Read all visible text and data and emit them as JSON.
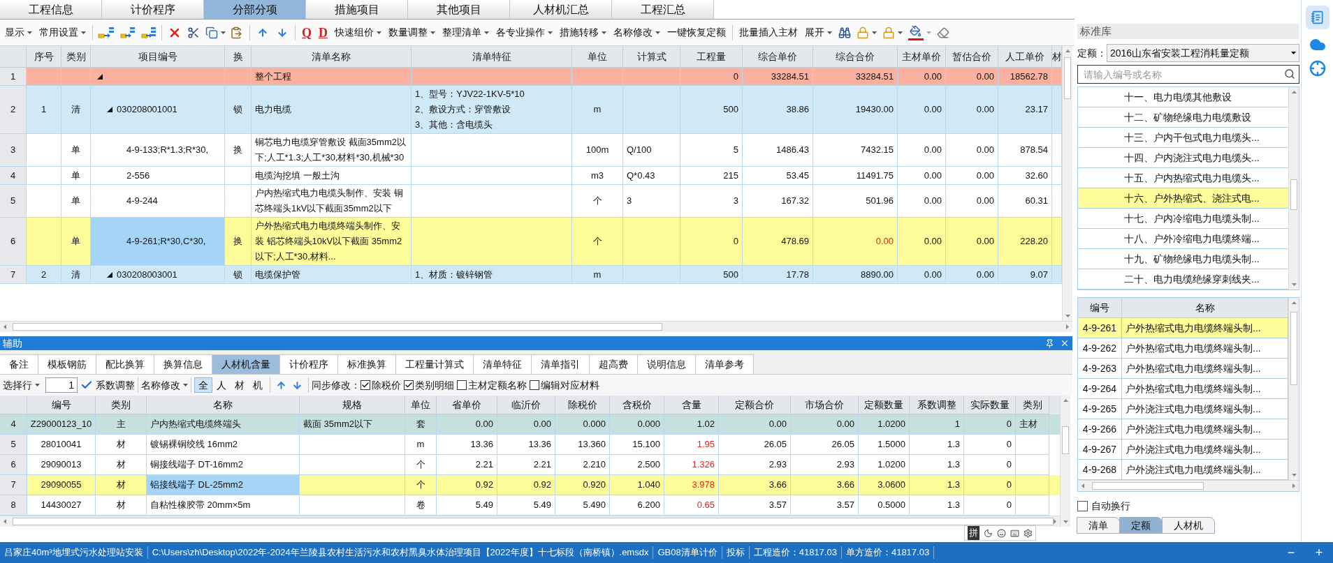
{
  "top_tabs": [
    {
      "label": "工程信息",
      "selected": false
    },
    {
      "label": "计价程序",
      "selected": false
    },
    {
      "label": "分部分项",
      "selected": true
    },
    {
      "label": "措施项目",
      "selected": false
    },
    {
      "label": "其他项目",
      "selected": false
    },
    {
      "label": "人材机汇总",
      "selected": false
    },
    {
      "label": "工程汇总",
      "selected": false
    }
  ],
  "toolbar": {
    "menus_a": [
      {
        "label": "显示",
        "dropdown": true
      },
      {
        "label": "常用设置",
        "dropdown": true
      }
    ],
    "marks": [
      "Q",
      "D"
    ],
    "menus_b": [
      {
        "label": "快速组价",
        "dropdown": true
      },
      {
        "label": "数量调整",
        "dropdown": true
      },
      {
        "label": "整理清单",
        "dropdown": true
      },
      {
        "label": "各专业操作",
        "dropdown": true
      },
      {
        "label": "措施转移",
        "dropdown": true
      },
      {
        "label": "名称修改",
        "dropdown": true
      },
      {
        "label": "一键恢复定额",
        "dropdown": false
      }
    ],
    "menus_c": [
      {
        "label": "批量插入主材",
        "dropdown": false
      },
      {
        "label": "展开",
        "dropdown": true
      }
    ]
  },
  "main_table": {
    "columns": [
      "序号",
      "类别",
      "项目编号",
      "换",
      "清单名称",
      "清单特征",
      "单位",
      "计算式",
      "工程量",
      "综合单价",
      "综合合价",
      "主材单价",
      "暂估合价",
      "人工单价",
      "材"
    ],
    "rows": [
      {
        "row_no": "1",
        "expanded": true,
        "selected": false,
        "flagged": false,
        "cells": {
          "name": "整个工程",
          "qty": "0",
          "unit_price": "33284.51",
          "total": "33284.51",
          "main_mat": "0.00",
          "est": "0.00",
          "labor": "18562.78"
        },
        "children": [
          {
            "row_no": "2",
            "expanded": true,
            "selected": false,
            "flagged": false,
            "cells": {
              "seq": "1",
              "type": "清",
              "code": "030208001001",
              "swap": "锁",
              "name": "电力电缆",
              "feature": "1、型号：YJV22-1KV-5*10\n2、敷设方式：穿管敷设\n3、其他：含电缆头",
              "unit": "m",
              "qty": "500",
              "unit_price": "38.86",
              "total": "19430.00",
              "main_mat": "0.00",
              "est": "0.00",
              "labor": "23.17"
            },
            "children": [
              {
                "row_no": "3",
                "selected": false,
                "flagged": false,
                "cells": {
                  "type": "单",
                  "code": "4-9-133;R*1.3;R*30,",
                  "swap": "换",
                  "name": "铜芯电力电缆穿管敷设 截面35mm2以下;人工*1.3;人工*30,材料*30,机械*30",
                  "unit": "100m",
                  "formula": "Q/100",
                  "qty": "5",
                  "unit_price": "1486.43",
                  "total": "7432.15",
                  "main_mat": "0.00",
                  "est": "0.00",
                  "labor": "878.54"
                }
              },
              {
                "row_no": "4",
                "selected": false,
                "flagged": false,
                "cells": {
                  "type": "单",
                  "code": "2-556",
                  "name": "电缆沟挖填 一般土沟",
                  "unit": "m3",
                  "formula": "Q*0.43",
                  "qty": "215",
                  "unit_price": "53.45",
                  "total": "11491.75",
                  "main_mat": "0.00",
                  "est": "0.00",
                  "labor": "32.60"
                }
              },
              {
                "row_no": "5",
                "selected": false,
                "flagged": false,
                "cells": {
                  "type": "单",
                  "code": "4-9-244",
                  "name": "户内热缩式电力电缆头制作、安装 铜芯终端头1kV以下截面35mm2以下",
                  "unit": "个",
                  "formula": "3",
                  "qty": "3",
                  "unit_price": "167.32",
                  "total": "501.96",
                  "main_mat": "0.00",
                  "est": "0.00",
                  "labor": "60.31"
                }
              },
              {
                "row_no": "6",
                "selected": true,
                "flagged": true,
                "cells": {
                  "type": "单",
                  "code": "4-9-261;R*30,C*30,",
                  "swap": "换",
                  "name": "户外热缩式电力电缆终端头制作、安装 铝芯终端头10kV以下截面 35mm2以下;人工*30,材料...",
                  "unit": "个",
                  "qty": "0",
                  "unit_price": "478.69",
                  "total": "0.00",
                  "main_mat": "0.00",
                  "est": "0.00",
                  "labor": "228.20"
                }
              }
            ]
          },
          {
            "row_no": "7",
            "expanded": true,
            "selected": false,
            "flagged": false,
            "cells": {
              "seq": "2",
              "type": "清",
              "code": "030208003001",
              "swap": "锁",
              "name": "电缆保护管",
              "feature": "1、材质：镀锌钢管",
              "unit": "m",
              "qty": "500",
              "unit_price": "17.78",
              "total": "8890.00",
              "main_mat": "0.00",
              "est": "0.00",
              "labor": "9.07"
            }
          }
        ]
      }
    ]
  },
  "assist": {
    "title": "辅助",
    "tabs": [
      {
        "label": "备注",
        "selected": false
      },
      {
        "label": "模板钢筋",
        "selected": false
      },
      {
        "label": "配比换算",
        "selected": false
      },
      {
        "label": "换算信息",
        "selected": false
      },
      {
        "label": "人材机含量",
        "selected": true
      },
      {
        "label": "计价程序",
        "selected": false
      },
      {
        "label": "标准换算",
        "selected": false
      },
      {
        "label": "工程量计算式",
        "selected": false
      },
      {
        "label": "清单特征",
        "selected": false
      },
      {
        "label": "清单指引",
        "selected": false
      },
      {
        "label": "超高费",
        "selected": false
      },
      {
        "label": "说明信息",
        "selected": false
      },
      {
        "label": "清单参考",
        "selected": false
      }
    ],
    "toolbar": {
      "select_row": "选择行",
      "row_value": "1",
      "coef": "系数调整",
      "rename": "名称修改",
      "filters": [
        {
          "label": "全",
          "selected": true
        },
        {
          "label": "人",
          "selected": false
        },
        {
          "label": "材",
          "selected": false
        },
        {
          "label": "机",
          "selected": false
        }
      ],
      "sync_label": "同步修改：",
      "options": [
        {
          "label": "除税价",
          "checked": true
        },
        {
          "label": "类别明细",
          "checked": true
        },
        {
          "label": "主材定额名称",
          "checked": false
        },
        {
          "label": "编辑对应材料",
          "checked": false
        }
      ]
    },
    "table": {
      "columns": [
        "编号",
        "类别",
        "名称",
        "规格",
        "单位",
        "省单价",
        "临沂价",
        "除税价",
        "含税价",
        "含量",
        "定额合价",
        "市场合价",
        "定额数量",
        "系数调整",
        "实际数量",
        "类别"
      ],
      "rows": [
        {
          "row_no": "4",
          "kind": "main",
          "selected": false,
          "changed": false,
          "cells": {
            "code": "Z29000123_10",
            "cat": "主",
            "name": "户内热缩式电缆终端头",
            "spec": "截面 35mm2以下",
            "unit": "套",
            "prov": "0.00",
            "linyi": "0.00",
            "notax": "0.000",
            "tax": "0.000",
            "content": "1.02",
            "quota_total": "0.00",
            "market_total": "0.00",
            "quota_qty": "1.0200",
            "coef": "1",
            "actual": "0",
            "category": "主材"
          }
        },
        {
          "row_no": "5",
          "kind": "material",
          "selected": false,
          "changed": true,
          "cells": {
            "code": "28010041",
            "cat": "材",
            "name": "镀锡裸铜绞线 16mm2",
            "unit": "m",
            "prov": "13.36",
            "linyi": "13.36",
            "notax": "13.360",
            "tax": "15.100",
            "content": "1.95",
            "quota_total": "26.05",
            "market_total": "26.05",
            "quota_qty": "1.5000",
            "coef": "1.3",
            "actual": "0"
          }
        },
        {
          "row_no": "6",
          "kind": "material",
          "selected": false,
          "changed": true,
          "cells": {
            "code": "29090013",
            "cat": "材",
            "name": "铜接线端子 DT-16mm2",
            "unit": "个",
            "prov": "2.21",
            "linyi": "2.21",
            "notax": "2.210",
            "tax": "2.500",
            "content": "1.326",
            "quota_total": "2.93",
            "market_total": "2.93",
            "quota_qty": "1.0200",
            "coef": "1.3",
            "actual": "0"
          }
        },
        {
          "row_no": "7",
          "kind": "material",
          "selected": true,
          "changed": true,
          "cells": {
            "code": "29090055",
            "cat": "材",
            "name": "铝接线端子 DL-25mm2",
            "unit": "个",
            "prov": "0.92",
            "linyi": "0.92",
            "notax": "0.920",
            "tax": "1.040",
            "content": "3.978",
            "quota_total": "3.66",
            "market_total": "3.66",
            "quota_qty": "3.0600",
            "coef": "1.3",
            "actual": "0"
          }
        },
        {
          "row_no": "8",
          "kind": "material",
          "selected": false,
          "changed": true,
          "cells": {
            "code": "14430027",
            "cat": "材",
            "name": "自粘性橡胶带 20mm×5m",
            "unit": "卷",
            "prov": "5.49",
            "linyi": "5.49",
            "notax": "5.490",
            "tax": "6.200",
            "content": "0.65",
            "quota_total": "3.57",
            "market_total": "3.57",
            "quota_qty": "0.5000",
            "coef": "1.3",
            "actual": "0"
          }
        }
      ]
    }
  },
  "library": {
    "title": "标准库",
    "quota_label": "定额：",
    "quota_value": "2016山东省安装工程消耗量定额",
    "search_placeholder": "请输入编号或名称",
    "chapters": [
      {
        "label": "十一、电力电缆其他敷设",
        "selected": false
      },
      {
        "label": "十二、矿物绝缘电力电缆敷设",
        "selected": false
      },
      {
        "label": "十三、户内干包式电力电缆头...",
        "selected": false
      },
      {
        "label": "十四、户内浇注式电力电缆头...",
        "selected": false
      },
      {
        "label": "十五、户内热缩式电力电缆头...",
        "selected": false
      },
      {
        "label": "十六、户外热缩式、浇注式电...",
        "selected": true
      },
      {
        "label": "十七、户内冷缩电力电缆头制...",
        "selected": false
      },
      {
        "label": "十八、户外冷缩电力电缆终端...",
        "selected": false
      },
      {
        "label": "十九、矿物绝缘电力电缆头制...",
        "selected": false
      },
      {
        "label": "二十、电力电缆绝缘穿刺线夹...",
        "selected": false
      }
    ],
    "items": {
      "columns": [
        "编号",
        "名称"
      ],
      "rows": [
        {
          "code": "4-9-261",
          "name": "户外热缩式电力电缆终端头制...",
          "selected": true
        },
        {
          "code": "4-9-262",
          "name": "户外热缩式电力电缆终端头制...",
          "selected": false
        },
        {
          "code": "4-9-263",
          "name": "户外热缩式电力电缆终端头制...",
          "selected": false
        },
        {
          "code": "4-9-264",
          "name": "户外热缩式电力电缆终端头制...",
          "selected": false
        },
        {
          "code": "4-9-265",
          "name": "户外浇注式电力电缆终端头制...",
          "selected": false
        },
        {
          "code": "4-9-266",
          "name": "户外浇注式电力电缆终端头制...",
          "selected": false
        },
        {
          "code": "4-9-267",
          "name": "户外浇注式电力电缆终端头制...",
          "selected": false
        },
        {
          "code": "4-9-268",
          "name": "户外浇注式电力电缆终端头制...",
          "selected": false
        }
      ]
    },
    "auto_wrap": {
      "label": "自动换行",
      "checked": false
    },
    "tabs": [
      {
        "label": "清单",
        "selected": false
      },
      {
        "label": "定额",
        "selected": true
      },
      {
        "label": "人材机",
        "selected": false
      }
    ]
  },
  "ime": {
    "mode": "拼"
  },
  "status_bar": {
    "items": [
      "吕家庄40m³地埋式污水处理站安装",
      "C:\\Users\\zh\\Desktop\\2022年-2024年兰陵县农村生活污水和农村黑臭水体治理项目【2022年度】十七标段（南桥镇）.emsdx",
      "GB08清单计价",
      "投标",
      "工程造价：41817.03",
      "单方造价：41817.03"
    ],
    "controls": [
      "−",
      "+"
    ]
  }
}
